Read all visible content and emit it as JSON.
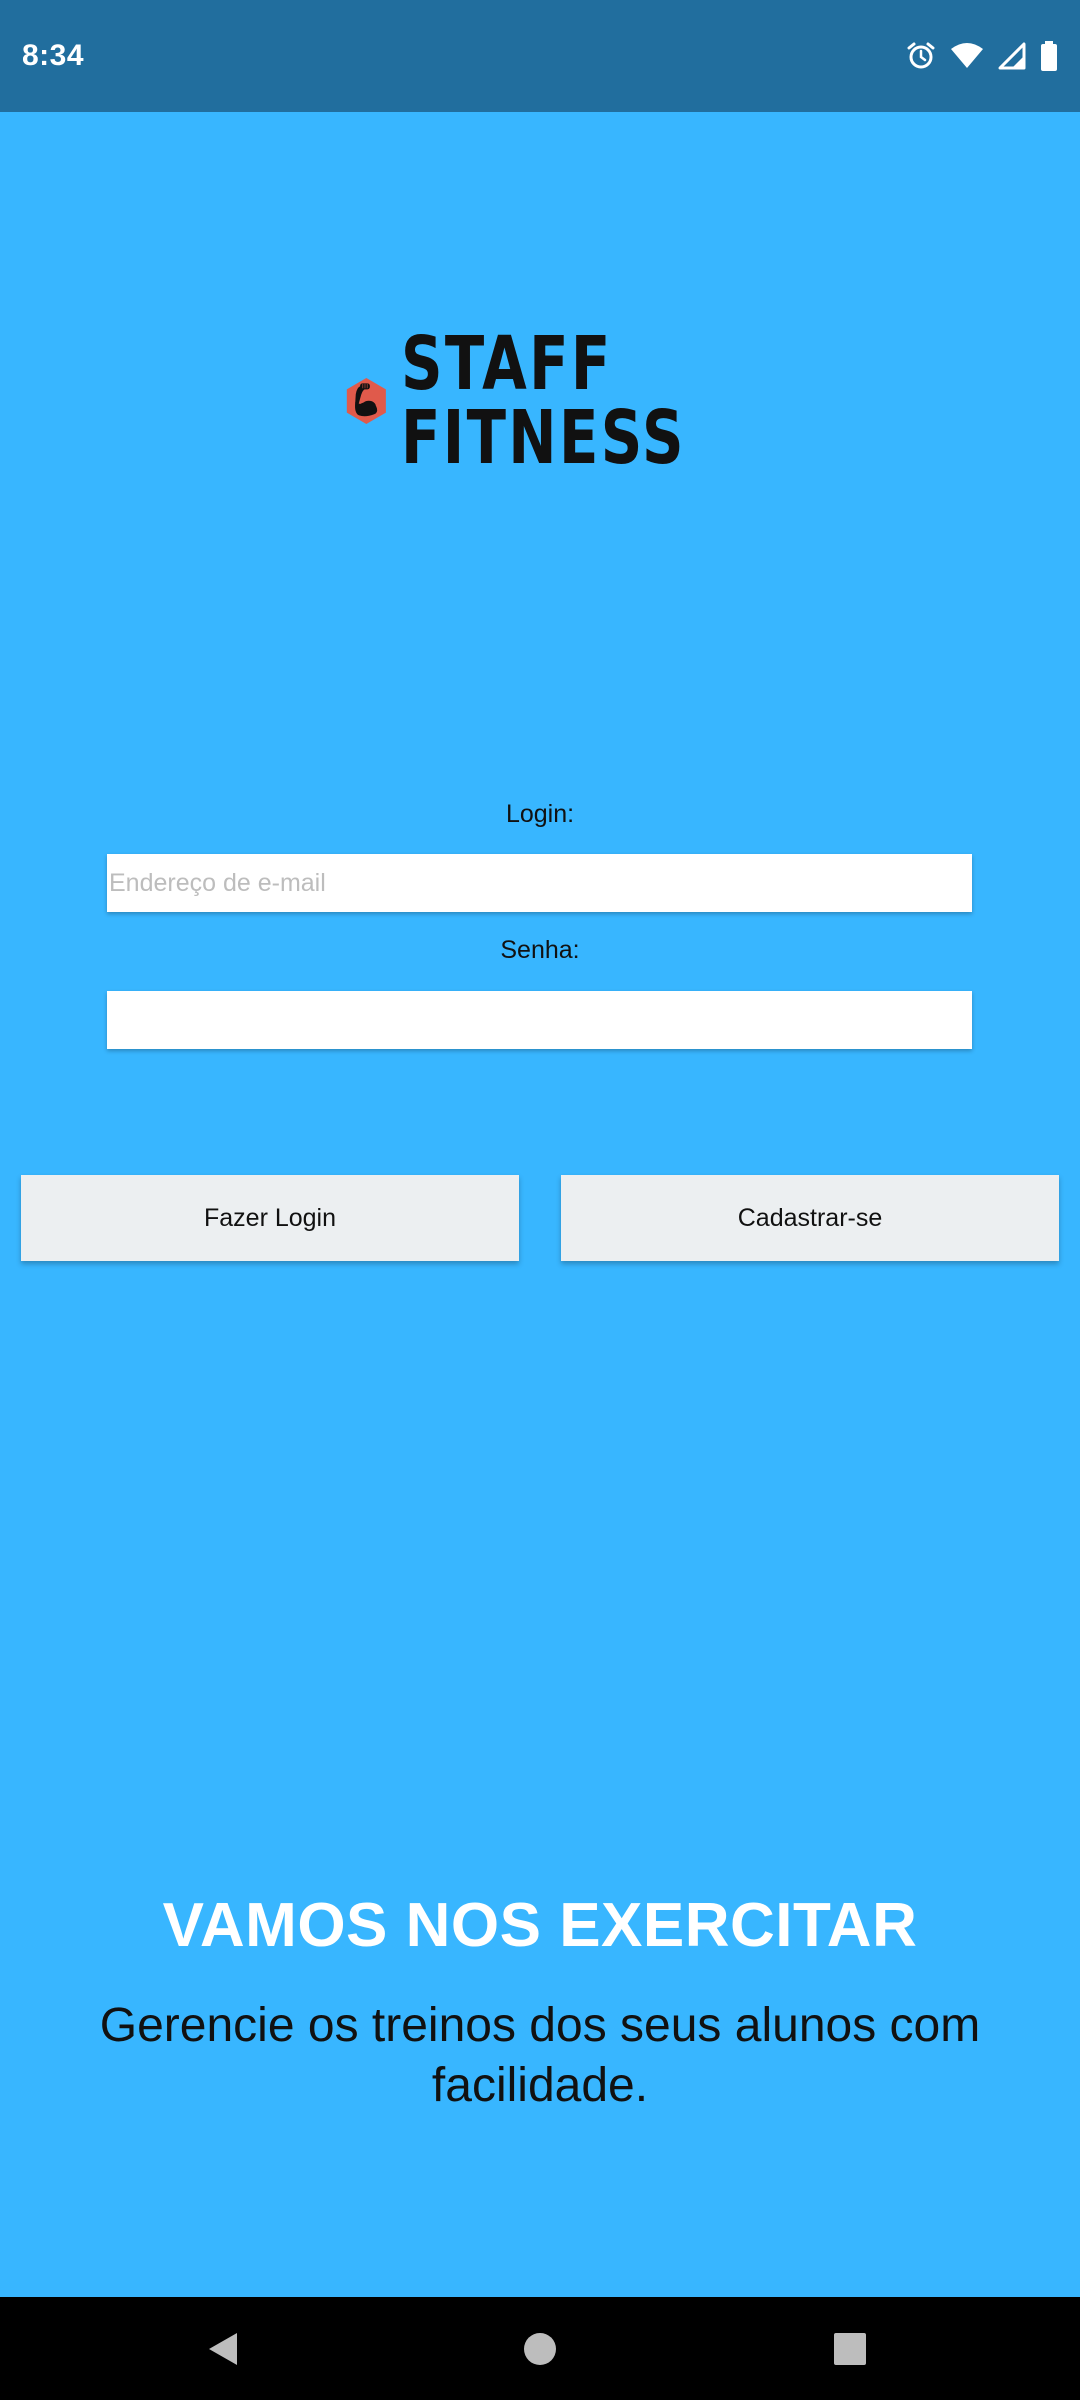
{
  "status_bar": {
    "time": "8:34",
    "icons": [
      "alarm-icon",
      "wifi-icon",
      "signal-icon",
      "battery-icon"
    ]
  },
  "logo": {
    "line1": "STAFF",
    "line2": "FITNESS",
    "hex_color": "#E05A4B"
  },
  "form": {
    "login_label": "Login:",
    "email_placeholder": "Endereço de e-mail",
    "email_value": "",
    "password_label": "Senha:",
    "password_value": ""
  },
  "buttons": {
    "login": "Fazer Login",
    "register": "Cadastrar-se"
  },
  "promo": {
    "headline": "VAMOS NOS EXERCITAR",
    "subtitle": "Gerencie os treinos dos seus alunos com facilidade."
  },
  "colors": {
    "background": "#38B6FF",
    "status_bar": "#216E9E",
    "button_bg": "#ECEFF1"
  },
  "nav": {
    "icons": [
      "back-icon",
      "home-icon",
      "recents-icon"
    ]
  }
}
